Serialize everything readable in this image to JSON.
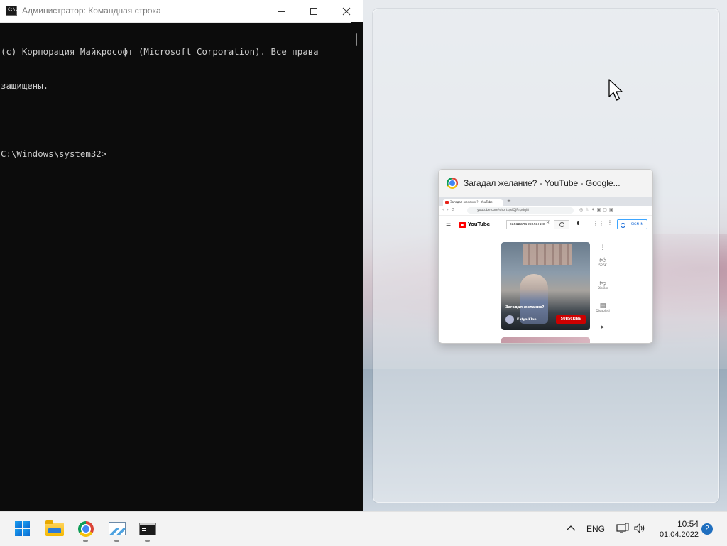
{
  "cmd": {
    "title": "Администратор: Командная строка",
    "icon_text": "C:\\.",
    "lines": [
      "(c) Корпорация Майкрософт (Microsoft Corporation). Все права",
      "защищены.",
      "",
      "C:\\Windows\\system32>"
    ]
  },
  "snap_assist": {
    "title": "Загадал желание? - YouTube - Google...",
    "preview": {
      "tab_title": "Загадал желание? - YouTube",
      "url": "youtube.com/shorts/xlQJRrpdqi8",
      "logo_text": "YouTube",
      "search_value": "загадала желание",
      "sign_in": "SIGN IN",
      "caption": "Загадал желание?",
      "channel": "Katya Klon",
      "subscribe": "SUBSCRIBE",
      "likes": "526K",
      "dislike_label": "Dislike",
      "comments_label": "Disabled"
    }
  },
  "taskbar": {
    "apps": [
      {
        "name": "start-button",
        "icon": "windows-logo-icon",
        "running": false
      },
      {
        "name": "file-explorer",
        "icon": "folder-icon",
        "running": false
      },
      {
        "name": "google-chrome",
        "icon": "chrome-icon",
        "running": true
      },
      {
        "name": "performance-monitor",
        "icon": "perfmon-icon",
        "running": true
      },
      {
        "name": "command-prompt",
        "icon": "cmd-icon",
        "running": true
      }
    ],
    "tray": {
      "language": "ENG",
      "time": "10:54",
      "date": "01.04.2022",
      "notifications": "2"
    }
  },
  "colors": {
    "cmd_bg": "#0c0c0c",
    "cmd_text": "#cccccc",
    "taskbar_bg": "#f3f3f3",
    "accent": "#1f6fbf"
  }
}
